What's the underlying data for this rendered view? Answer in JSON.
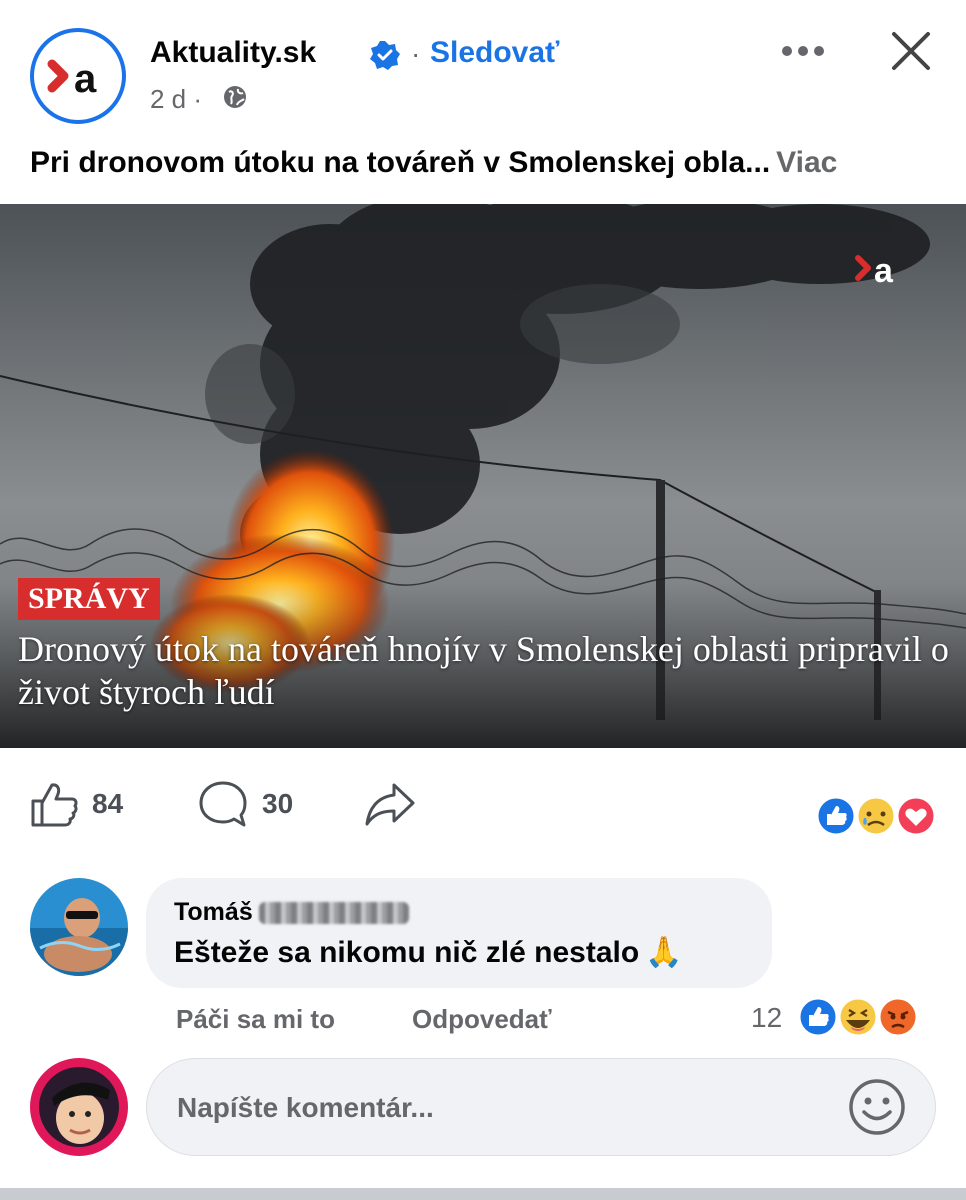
{
  "header": {
    "page_name": "Aktuality.sk",
    "separator": "·",
    "follow_label": "Sledovať",
    "time": "2 d ·",
    "logo_text": "›a"
  },
  "post": {
    "text": "Pri dronovom útoku na továreň v Smolenskej obla...",
    "more_label": "Viac"
  },
  "image": {
    "badge": "SPRÁVY",
    "headline": "Dronový útok na továreň hnojív v Smolenskej oblasti pripravil o život štyroch ľudí",
    "watermark": "›a"
  },
  "actions": {
    "likes": "84",
    "comments": "30"
  },
  "comment": {
    "author": "Tomáš",
    "text": "Ešteže sa nikomu nič zlé nestalo",
    "emoji": "🙏",
    "like_label": "Páči sa mi to",
    "reply_label": "Odpovedať",
    "reaction_count": "12"
  },
  "composer": {
    "placeholder": "Napíšte komentár..."
  },
  "colors": {
    "accent": "#1b74e4",
    "badge_red": "#d82d2d",
    "muted": "#65676b"
  }
}
